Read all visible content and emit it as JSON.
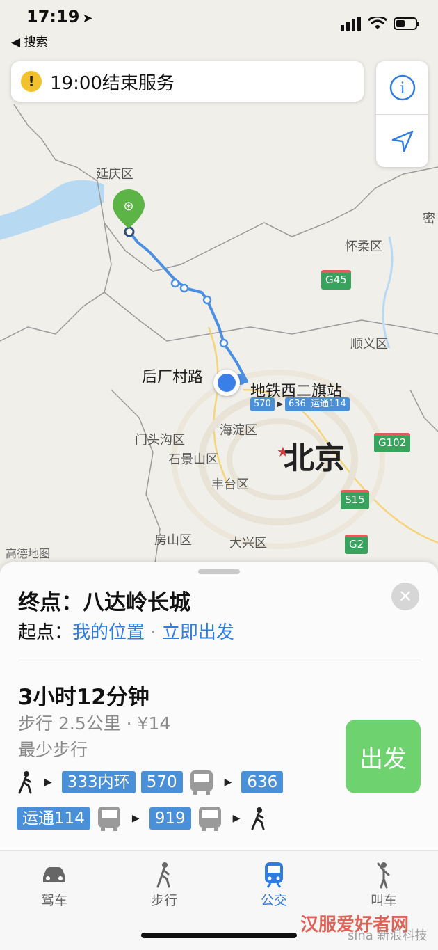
{
  "status": {
    "time": "17:19",
    "back_label": "◀ 搜索"
  },
  "alert": {
    "text": "19:00结束服务"
  },
  "map": {
    "labels": {
      "yanqing": "延庆区",
      "huairou": "怀柔区",
      "mi": "密",
      "shunyi": "顺义区",
      "houchangcun": "后厂村路",
      "station": "地铁西二旗站",
      "haidian": "海淀区",
      "mentougou": "门头沟区",
      "shijingshan": "石景山区",
      "beijing": "北京",
      "fengtai": "丰台区",
      "fangshan": "房山区",
      "daxing": "大兴区",
      "attribution": "高德地图"
    },
    "shields": {
      "g45": "G45",
      "g102": "G102",
      "s15": "S15",
      "g2": "G2"
    },
    "route_tags": {
      "t1": "570",
      "t2": "636",
      "t3": "运通114"
    }
  },
  "sheet": {
    "destination": "终点：八达岭长城",
    "origin_prefix": "起点：",
    "origin_value": "我的位置",
    "dot": " · ",
    "depart_time": "立即出发",
    "duration": "3小时12分钟",
    "walk_info": "步行 2.5公里 · ¥14",
    "least_walk": "最少步行",
    "go_label": "出发",
    "route_row1": [
      "333内环",
      "570",
      "636"
    ],
    "route_row2": [
      "运通114",
      "919"
    ]
  },
  "tabs": [
    {
      "label": "驾车",
      "icon": "car-icon"
    },
    {
      "label": "步行",
      "icon": "walk-icon"
    },
    {
      "label": "公交",
      "icon": "train-icon",
      "active": true
    },
    {
      "label": "叫车",
      "icon": "hail-icon"
    }
  ],
  "watermark": {
    "text": "汉服爱好者网",
    "sub": "sina 新浪科技"
  },
  "colors": {
    "accent": "#2f7de1",
    "go_button": "#6ed36e",
    "route_badge": "#4a90d9",
    "alert": "#f2c12e"
  }
}
